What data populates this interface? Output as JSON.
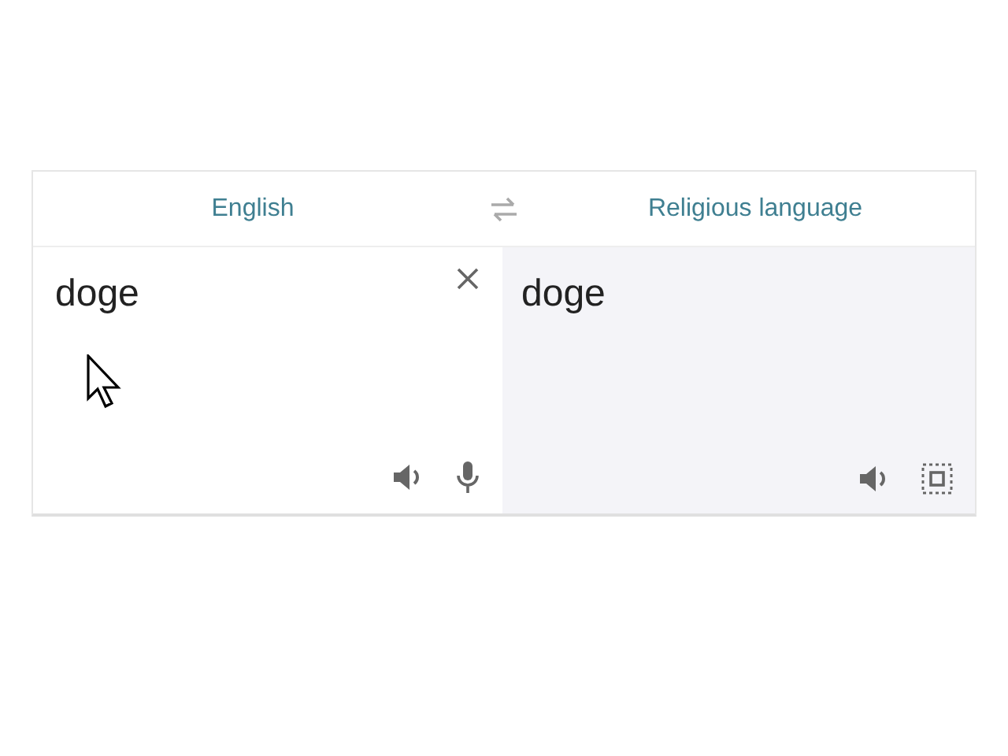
{
  "languages": {
    "source": "English",
    "target": "Religious language"
  },
  "source_text": "doge",
  "translation": "doge"
}
